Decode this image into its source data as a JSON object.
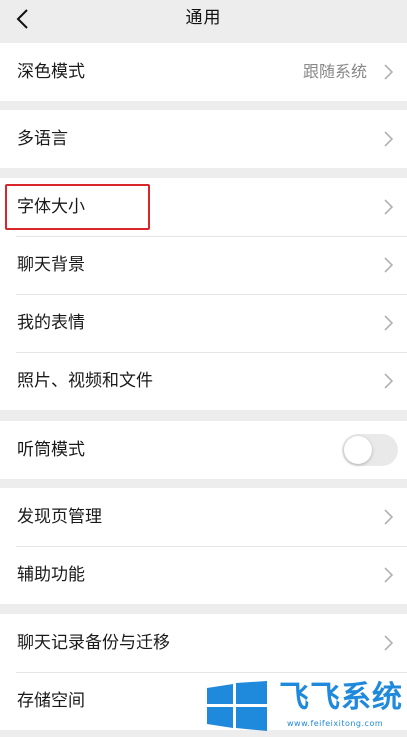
{
  "header": {
    "title": "通用"
  },
  "groups": [
    [
      {
        "label": "深色模式",
        "value": "跟随系统"
      }
    ],
    [
      {
        "label": "多语言"
      }
    ],
    [
      {
        "label": "字体大小"
      },
      {
        "label": "聊天背景"
      },
      {
        "label": "我的表情"
      },
      {
        "label": "照片、视频和文件"
      }
    ],
    [
      {
        "label": "听筒模式",
        "toggle": "off"
      }
    ],
    [
      {
        "label": "发现页管理"
      },
      {
        "label": "辅助功能"
      }
    ],
    [
      {
        "label": "聊天记录备份与迁移"
      },
      {
        "label": "存储空间"
      }
    ]
  ],
  "watermark": {
    "text": "飞飞系统",
    "url": "www.feifeixitong.com"
  },
  "colors": {
    "highlight": "#d9262b",
    "watermark": "#1f89dc",
    "background": "#ededed"
  }
}
